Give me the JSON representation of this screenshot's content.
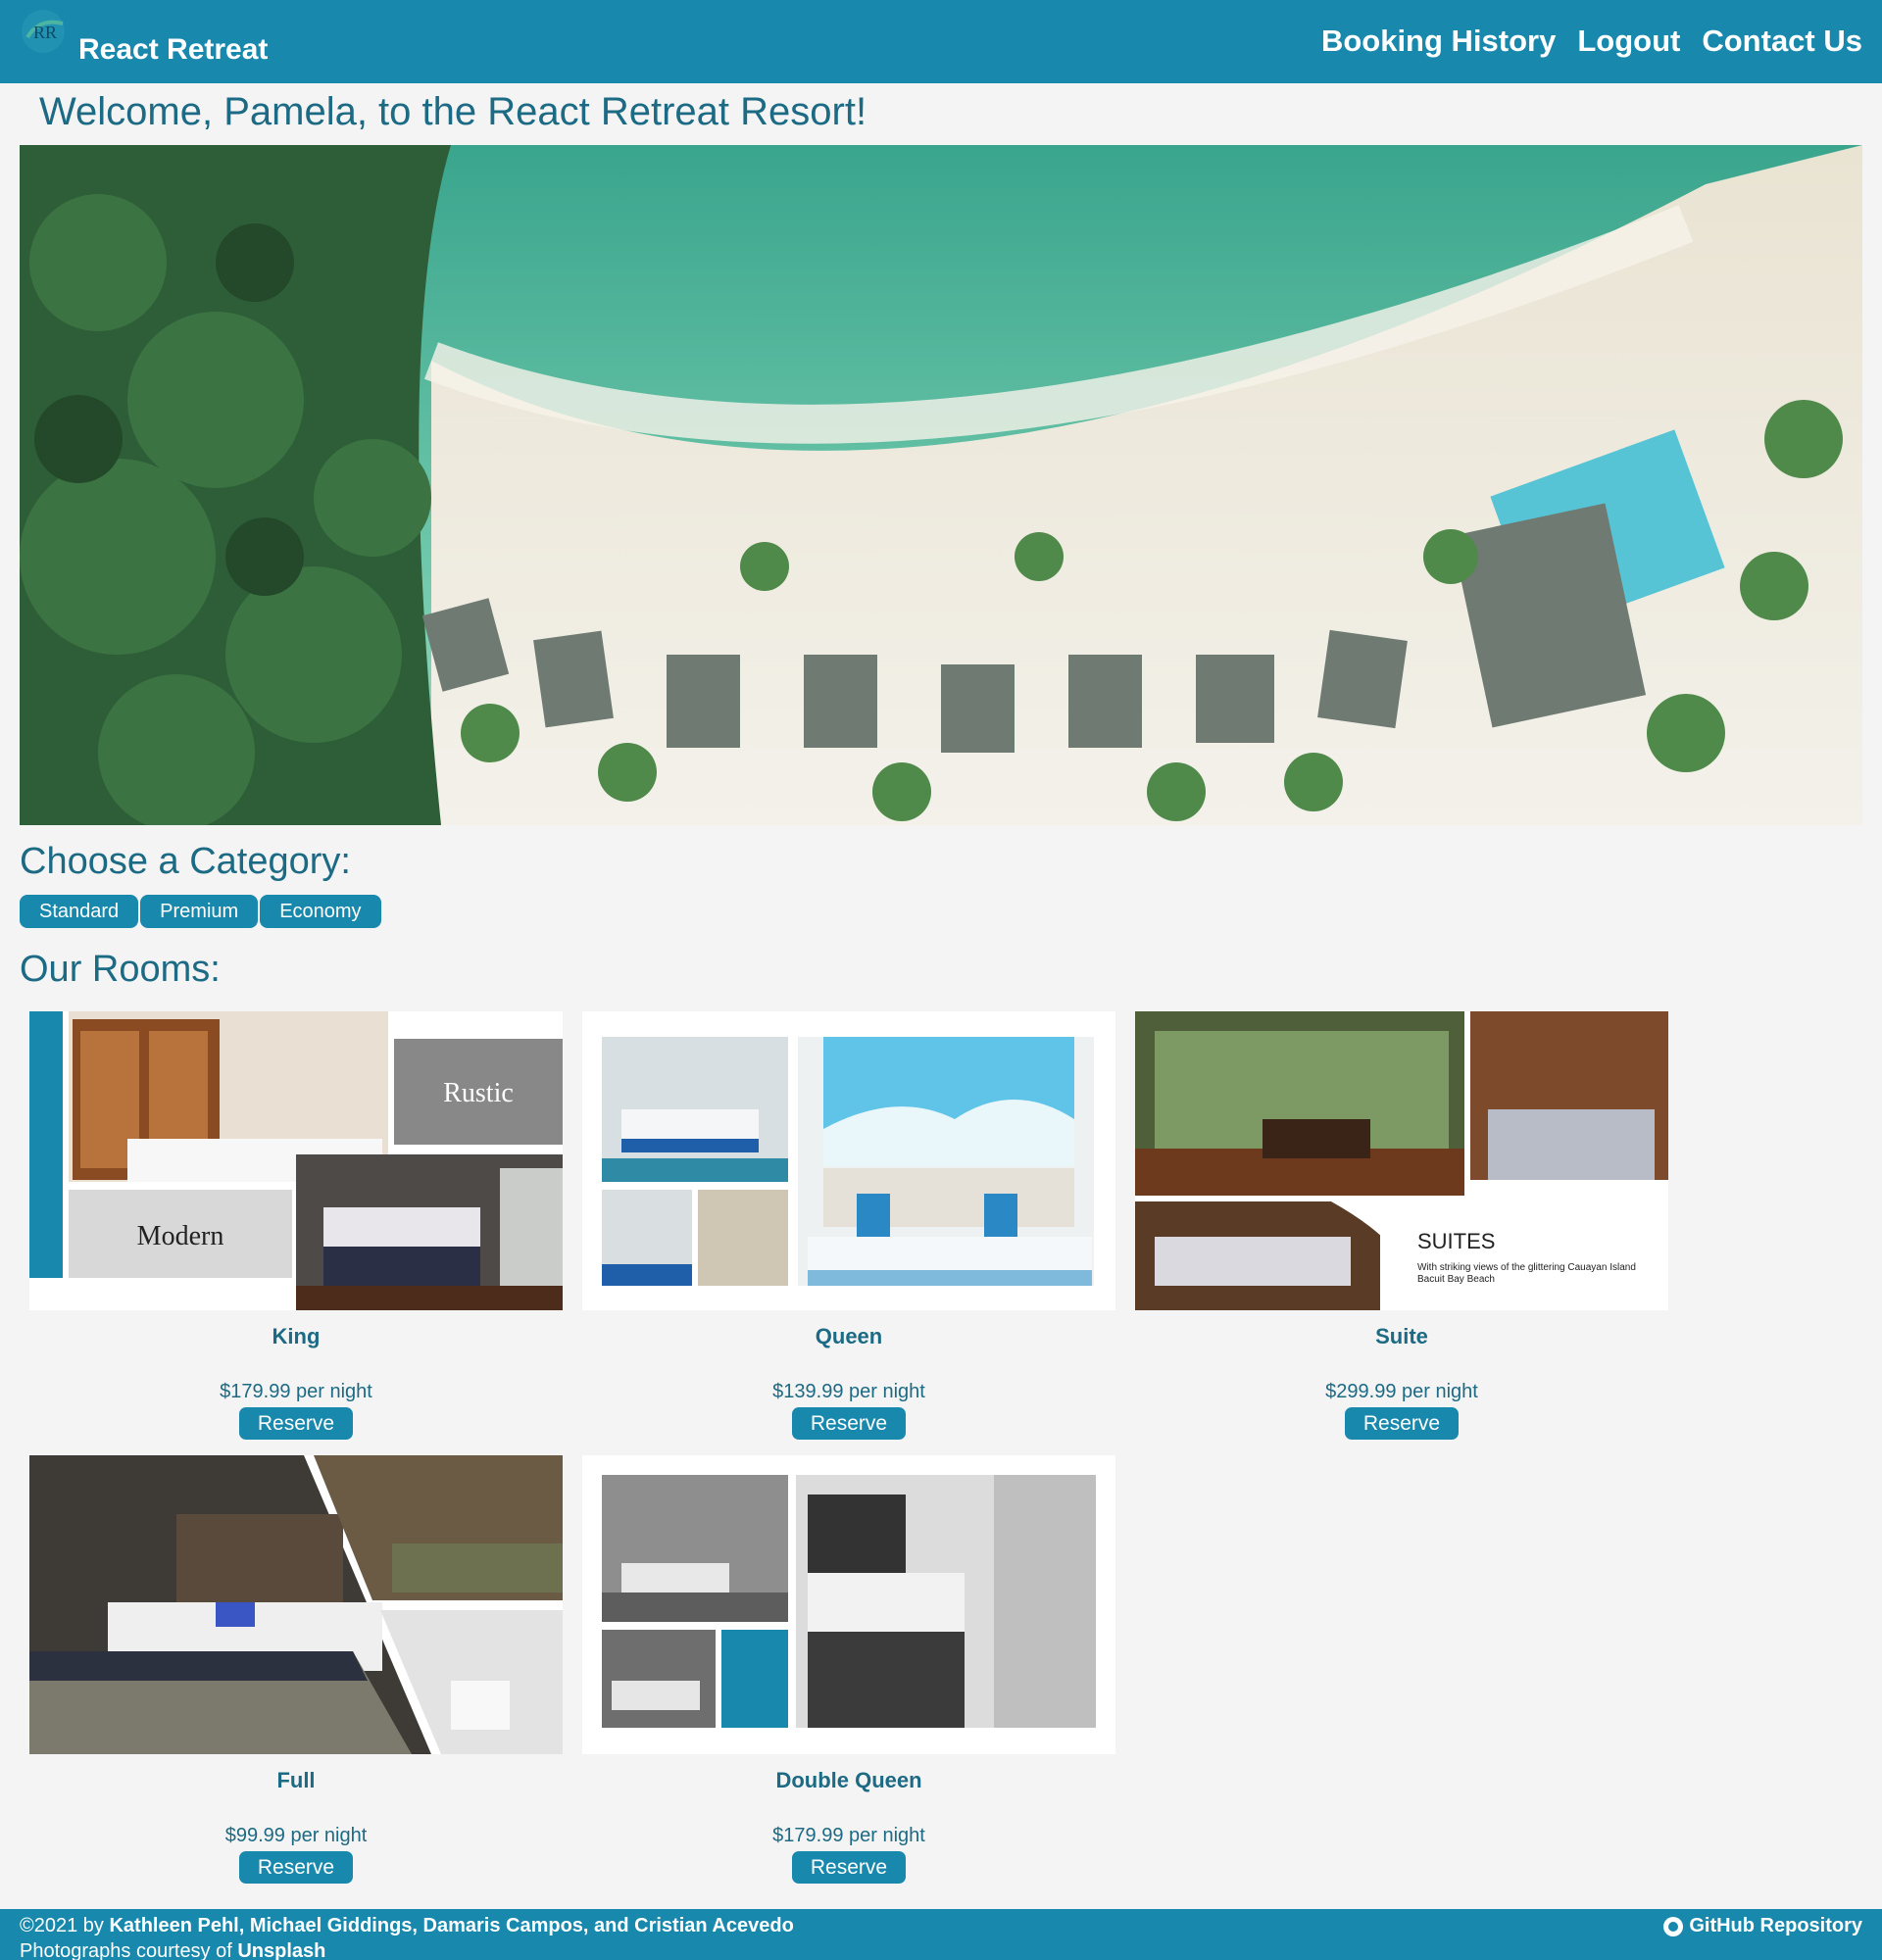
{
  "header": {
    "logo_text": "RR",
    "brand": "React Retreat",
    "nav": [
      "Booking History",
      "Logout",
      "Contact Us"
    ]
  },
  "welcome": "Welcome, Pamela, to the React Retreat Resort!",
  "category": {
    "heading": "Choose a Category:",
    "options": [
      "Standard",
      "Premium",
      "Economy"
    ]
  },
  "rooms": {
    "heading": "Our Rooms:",
    "items": [
      {
        "name": "King",
        "price": "$179.99 per night",
        "reserve": "Reserve",
        "collage_labels": [
          "Rustic",
          "Modern"
        ]
      },
      {
        "name": "Queen",
        "price": "$139.99 per night",
        "reserve": "Reserve"
      },
      {
        "name": "Suite",
        "price": "$299.99 per night",
        "reserve": "Reserve",
        "collage_labels": [
          "SUITES",
          "With striking views of the glittering Cauayan Island",
          "Bacuit Bay Beach"
        ]
      },
      {
        "name": "Full",
        "price": "$99.99 per night",
        "reserve": "Reserve"
      },
      {
        "name": "Double Queen",
        "price": "$179.99 per night",
        "reserve": "Reserve"
      }
    ]
  },
  "footer": {
    "copyright_prefix": "©2021 by ",
    "authors": "Kathleen Pehl, Michael Giddings, Damaris Campos, and Cristian Acevedo",
    "photos_prefix": "Photographs courtesy of ",
    "photos_source": "Unsplash",
    "repo": "GitHub Repository",
    "repo_icon": "github-icon"
  },
  "colors": {
    "primary": "#1888ad",
    "text": "#1c6a84",
    "background": "#f4f4f4"
  }
}
